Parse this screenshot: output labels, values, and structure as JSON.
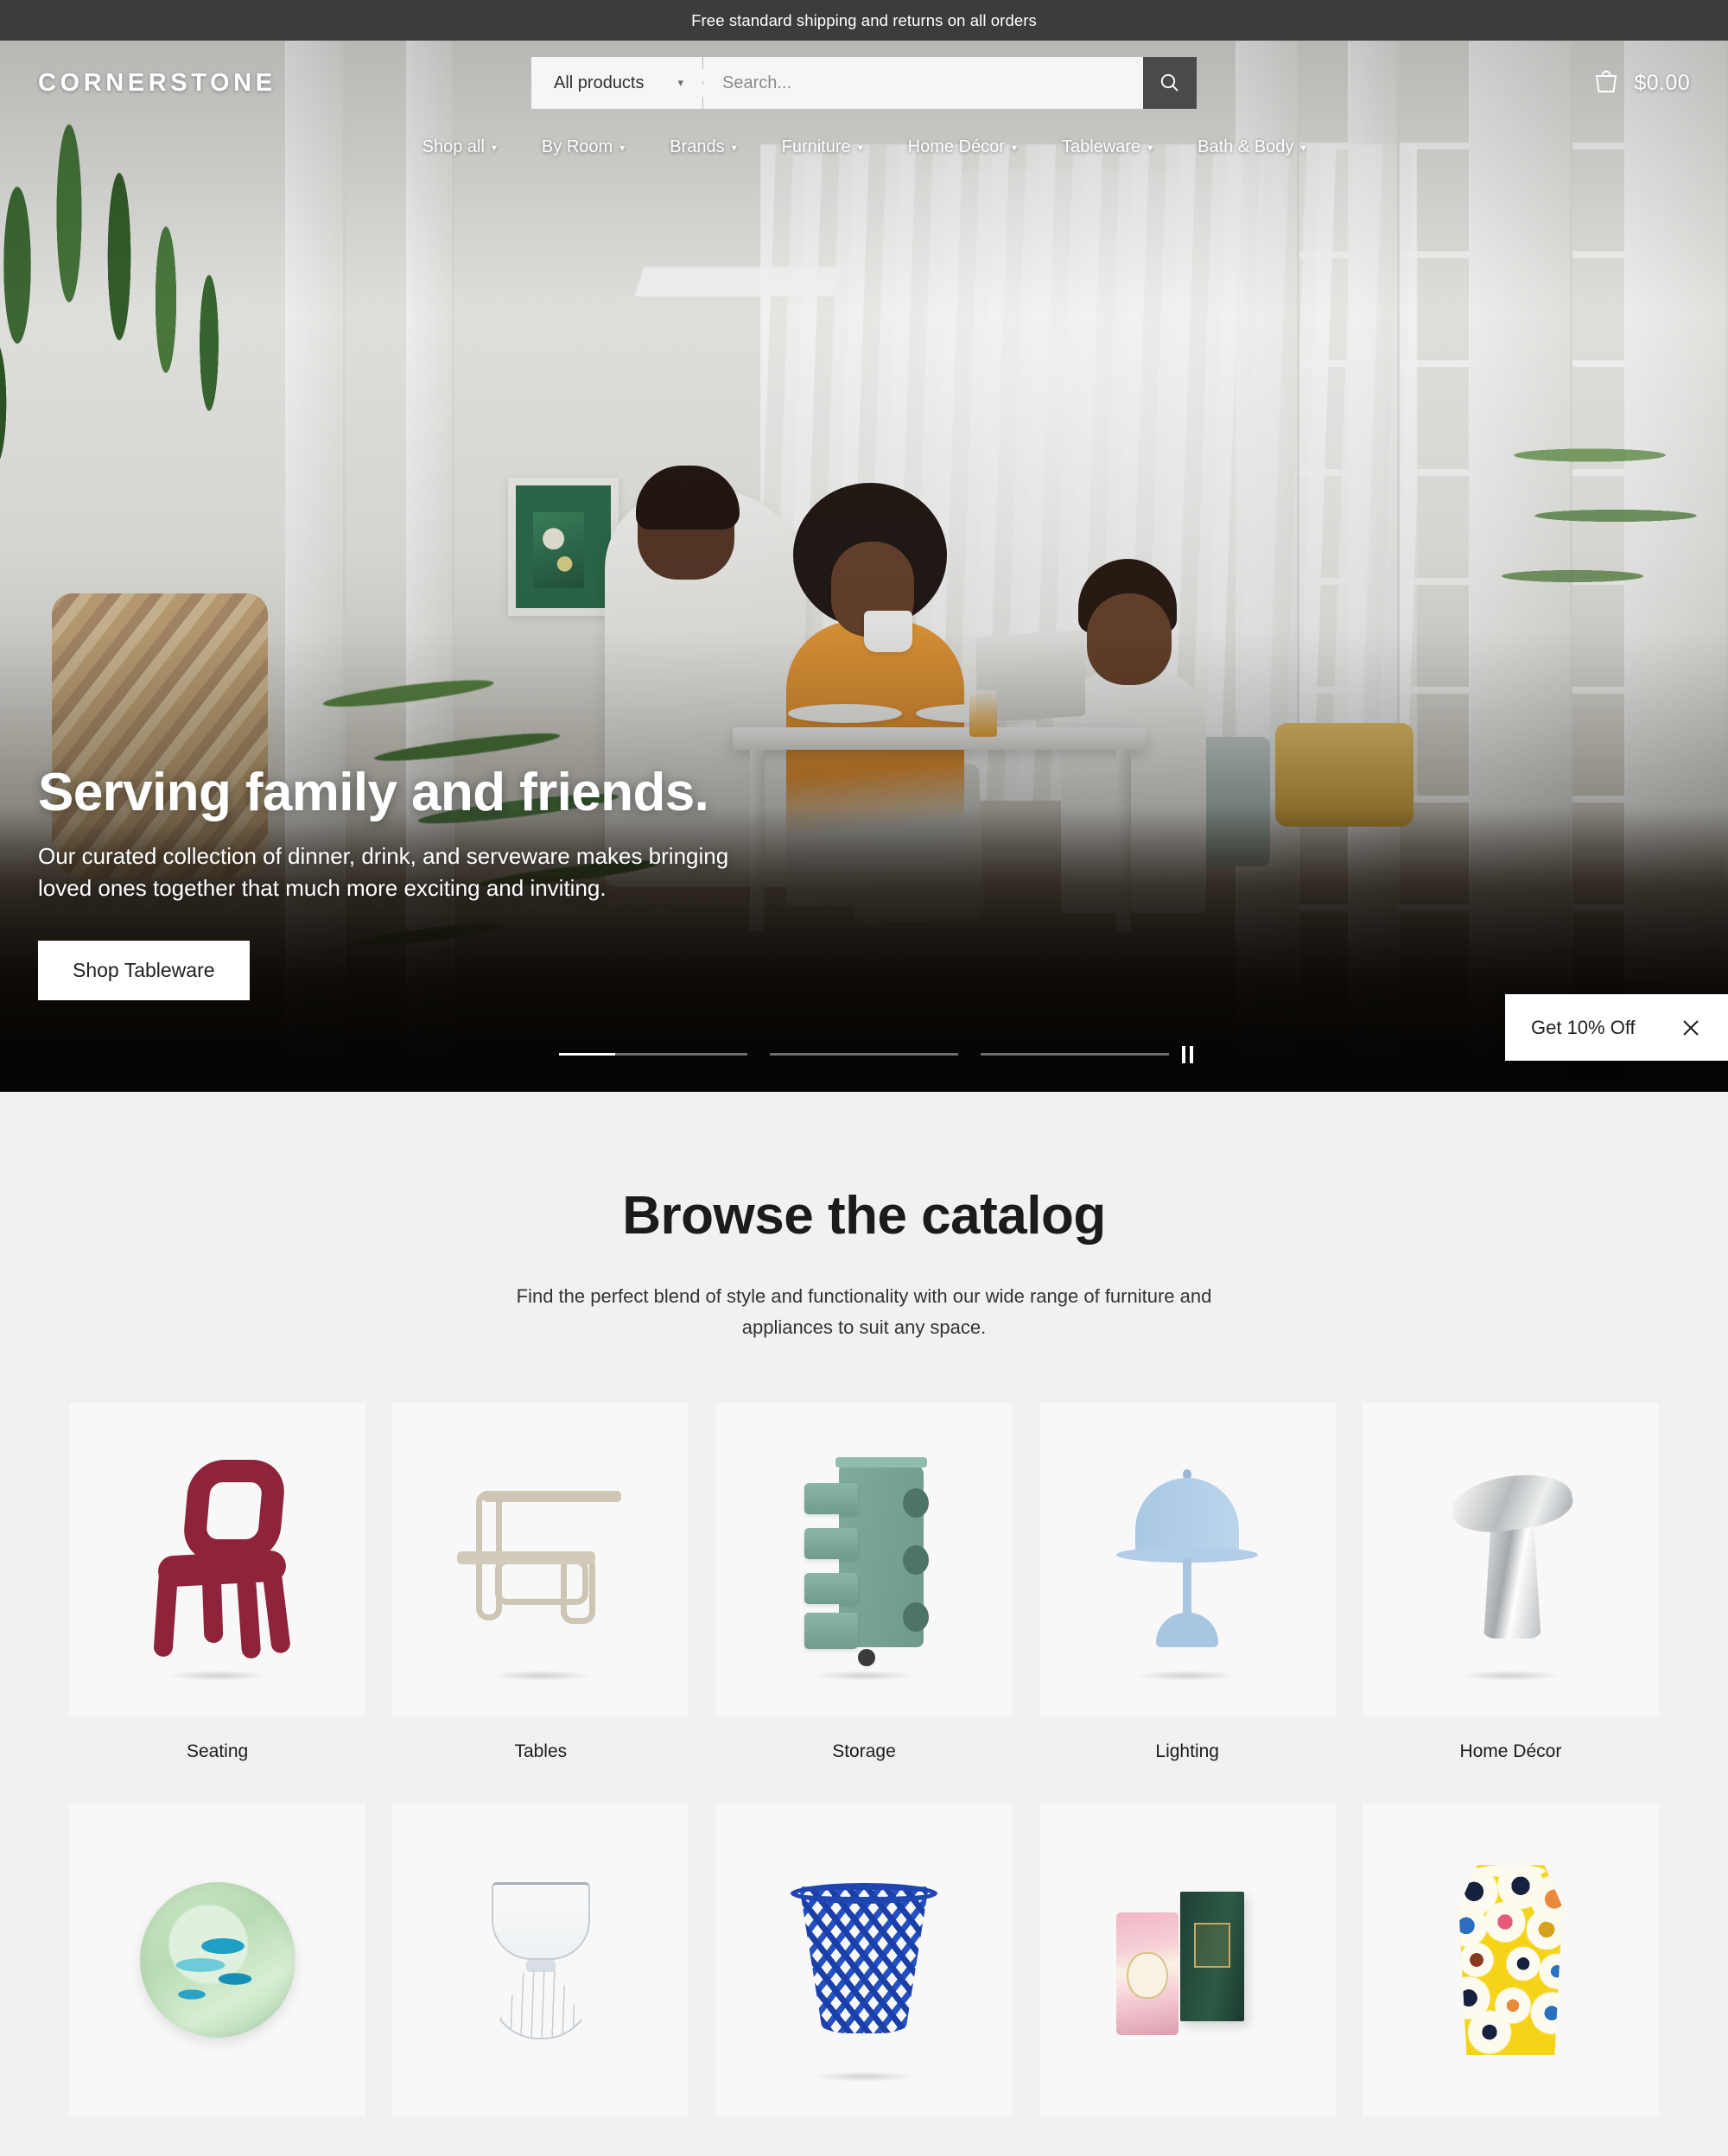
{
  "announcement": {
    "text": "Free standard shipping and returns on all orders"
  },
  "header": {
    "logo": "CORNERSTONE",
    "search": {
      "category_selected": "All products",
      "placeholder": "Search...",
      "search_icon": "search-icon",
      "caret_icon": "chevron-down-icon"
    },
    "cart": {
      "icon": "shopping-bag-icon",
      "total": "$0.00"
    }
  },
  "nav": {
    "items": [
      {
        "label": "Shop all",
        "caret": "⌄"
      },
      {
        "label": "By Room",
        "caret": "⌄"
      },
      {
        "label": "Brands",
        "caret": "⌄"
      },
      {
        "label": "Furniture",
        "caret": "⌄"
      },
      {
        "label": "Home Décor",
        "caret": "⌄"
      },
      {
        "label": "Tableware",
        "caret": "⌄"
      },
      {
        "label": "Bath & Body",
        "caret": "⌄"
      }
    ]
  },
  "hero": {
    "title": "Serving family and friends.",
    "subtitle": "Our curated collection of dinner, drink, and serveware makes bringing loved ones together that much more exciting and inviting.",
    "cta_label": "Shop Tableware",
    "image_alt": "Family of three eating breakfast at a white table in a bright room with plants",
    "carousel": {
      "slide_count": 3,
      "active_index": 0,
      "active_progress_percent": 30,
      "play_state": "playing",
      "pause_icon": "pause-icon"
    }
  },
  "promo": {
    "label": "Get 10% Off",
    "close_icon": "close-icon"
  },
  "catalog": {
    "title": "Browse the catalog",
    "subtitle": "Find the perfect blend of style and functionality with our wide range of furniture and appliances to suit any space.",
    "row1": [
      {
        "label": "Seating",
        "art": "chair",
        "accent": "#8e2339"
      },
      {
        "label": "Tables",
        "art": "table",
        "accent": "#cdc6b4"
      },
      {
        "label": "Storage",
        "art": "trolley",
        "accent": "#7fab9c"
      },
      {
        "label": "Lighting",
        "art": "lamp",
        "accent": "#a9c7e4"
      },
      {
        "label": "Home Décor",
        "art": "vase",
        "accent": "#c9cdd0"
      }
    ],
    "row2": [
      {
        "label": "",
        "art": "plate",
        "accent": "#b8dcb4"
      },
      {
        "label": "",
        "art": "glass",
        "accent": "#c6ccd2"
      },
      {
        "label": "",
        "art": "basket",
        "accent": "#1f45b0"
      },
      {
        "label": "",
        "art": "candle",
        "accent": "#2d5a46"
      },
      {
        "label": "",
        "art": "yvase",
        "accent": "#f5d318"
      }
    ]
  },
  "colors": {
    "announcement_bg": "#3c3c3c",
    "catalog_bg": "#f1f1f1",
    "card_bg": "#f8f8f8",
    "text_dark": "#1b1b1b",
    "accent_white": "#ffffff"
  }
}
